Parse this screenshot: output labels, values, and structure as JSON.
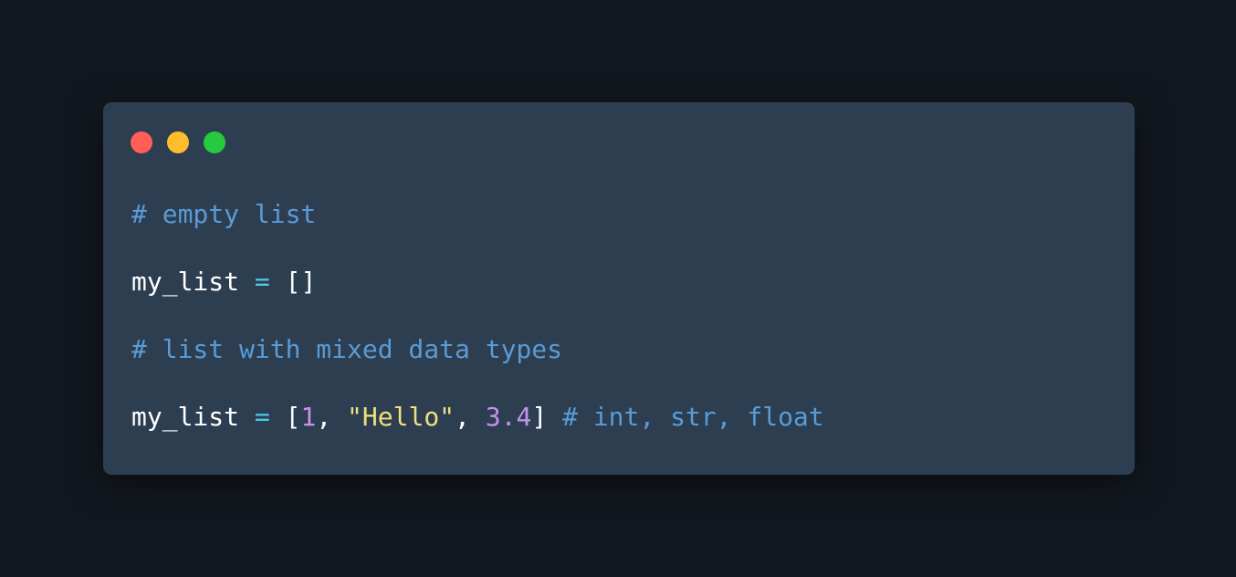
{
  "window": {
    "traffic_lights": [
      {
        "name": "close",
        "color": "#ff5f56"
      },
      {
        "name": "minimize",
        "color": "#ffbd2e"
      },
      {
        "name": "maximize",
        "color": "#27c93f"
      }
    ]
  },
  "code": {
    "line1": {
      "comment": "# empty list"
    },
    "line2": {
      "ident": "my_list",
      "op": " = ",
      "value": "[]"
    },
    "line3": {
      "comment": "# list with mixed data types"
    },
    "line4": {
      "ident": "my_list",
      "op": " = ",
      "open": "[",
      "num1": "1",
      "sep1": ", ",
      "str": "\"Hello\"",
      "sep2": ", ",
      "num2": "3.4",
      "close": "]",
      "space": " ",
      "comment": "# int, str, float"
    }
  }
}
